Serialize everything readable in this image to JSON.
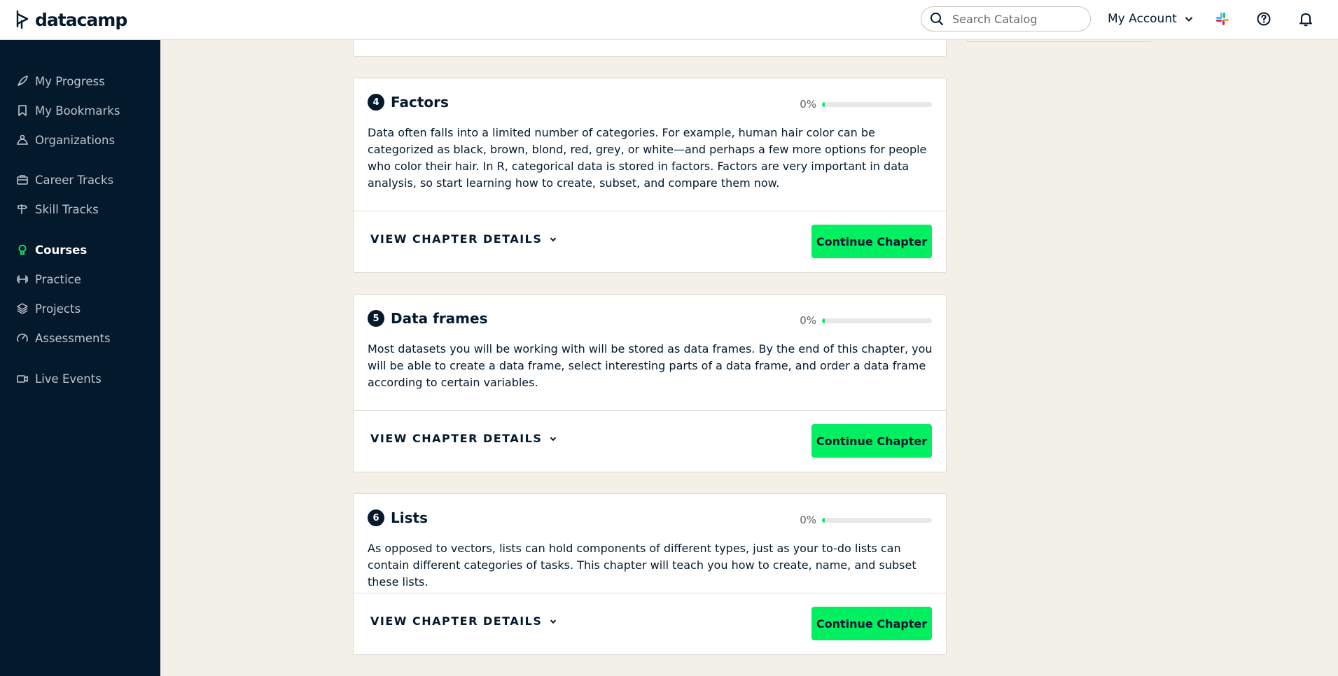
{
  "brand": {
    "name": "datacamp"
  },
  "topbar": {
    "search_placeholder": "Search Catalog",
    "account_label": "My Account"
  },
  "sidebar": {
    "items": [
      {
        "label": "My Progress",
        "icon": "rocket-icon"
      },
      {
        "label": "My Bookmarks",
        "icon": "bookmark-icon"
      },
      {
        "label": "Organizations",
        "icon": "organization-icon"
      },
      {
        "label": "Career Tracks",
        "icon": "briefcase-icon"
      },
      {
        "label": "Skill Tracks",
        "icon": "signpost-icon"
      },
      {
        "label": "Courses",
        "icon": "lightbulb-icon",
        "active": true
      },
      {
        "label": "Practice",
        "icon": "dumbbell-icon"
      },
      {
        "label": "Projects",
        "icon": "layers-icon"
      },
      {
        "label": "Assessments",
        "icon": "gauge-icon"
      },
      {
        "label": "Live Events",
        "icon": "video-icon"
      }
    ]
  },
  "chapters": [
    {
      "number": "4",
      "title": "Factors",
      "progress_label": "0%",
      "progress": 0,
      "description": "Data often falls into a limited number of categories. For example, human hair color can be categorized as black, brown, blond, red, grey, or white—and perhaps a few more options for people who color their hair. In R, categorical data is stored in factors. Factors are very important in data analysis, so start learning how to create, subset, and compare them now.",
      "details_label": "VIEW CHAPTER DETAILS",
      "button_label": "Continue Chapter"
    },
    {
      "number": "5",
      "title": "Data frames",
      "progress_label": "0%",
      "progress": 0,
      "description": "Most datasets you will be working with will be stored as data frames. By the end of this chapter, you will be able to create a data frame, select interesting parts of a data frame, and order a data frame according to certain variables.",
      "details_label": "VIEW CHAPTER DETAILS",
      "button_label": "Continue Chapter"
    },
    {
      "number": "6",
      "title": "Lists",
      "progress_label": "0%",
      "progress": 0,
      "description": "As opposed to vectors, lists can hold components of different types, just as your to-do lists can contain different categories of tasks. This chapter will teach you how to create, name, and subset these lists.",
      "details_label": "VIEW CHAPTER DETAILS",
      "button_label": "Continue Chapter"
    }
  ],
  "colors": {
    "navy": "#05192d",
    "accent_green": "#03ef62",
    "page_bg": "#f3f0e8"
  }
}
